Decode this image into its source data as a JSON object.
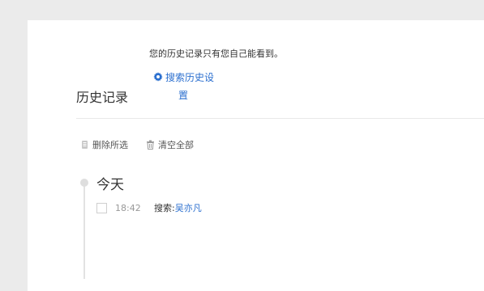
{
  "page": {
    "title": "历史记录",
    "privacy_note": "您的历史记录只有您自己能看到。",
    "settings_link_line1": "搜索历史设",
    "settings_link_line2": "置"
  },
  "actions": {
    "delete_selected": "删除所选",
    "clear_all": "清空全部"
  },
  "history": {
    "day_label": "今天",
    "entries": [
      {
        "time": "18:42",
        "prefix": "搜索:",
        "query": "吴亦凡",
        "checked": false
      }
    ]
  },
  "colors": {
    "background": "#ebebeb",
    "card": "#ffffff",
    "link": "#2b6fcf",
    "text": "#333333",
    "muted": "#999999"
  },
  "icons": {
    "settings": "gear-icon",
    "delete": "eraser-icon",
    "clear": "trash-icon"
  }
}
